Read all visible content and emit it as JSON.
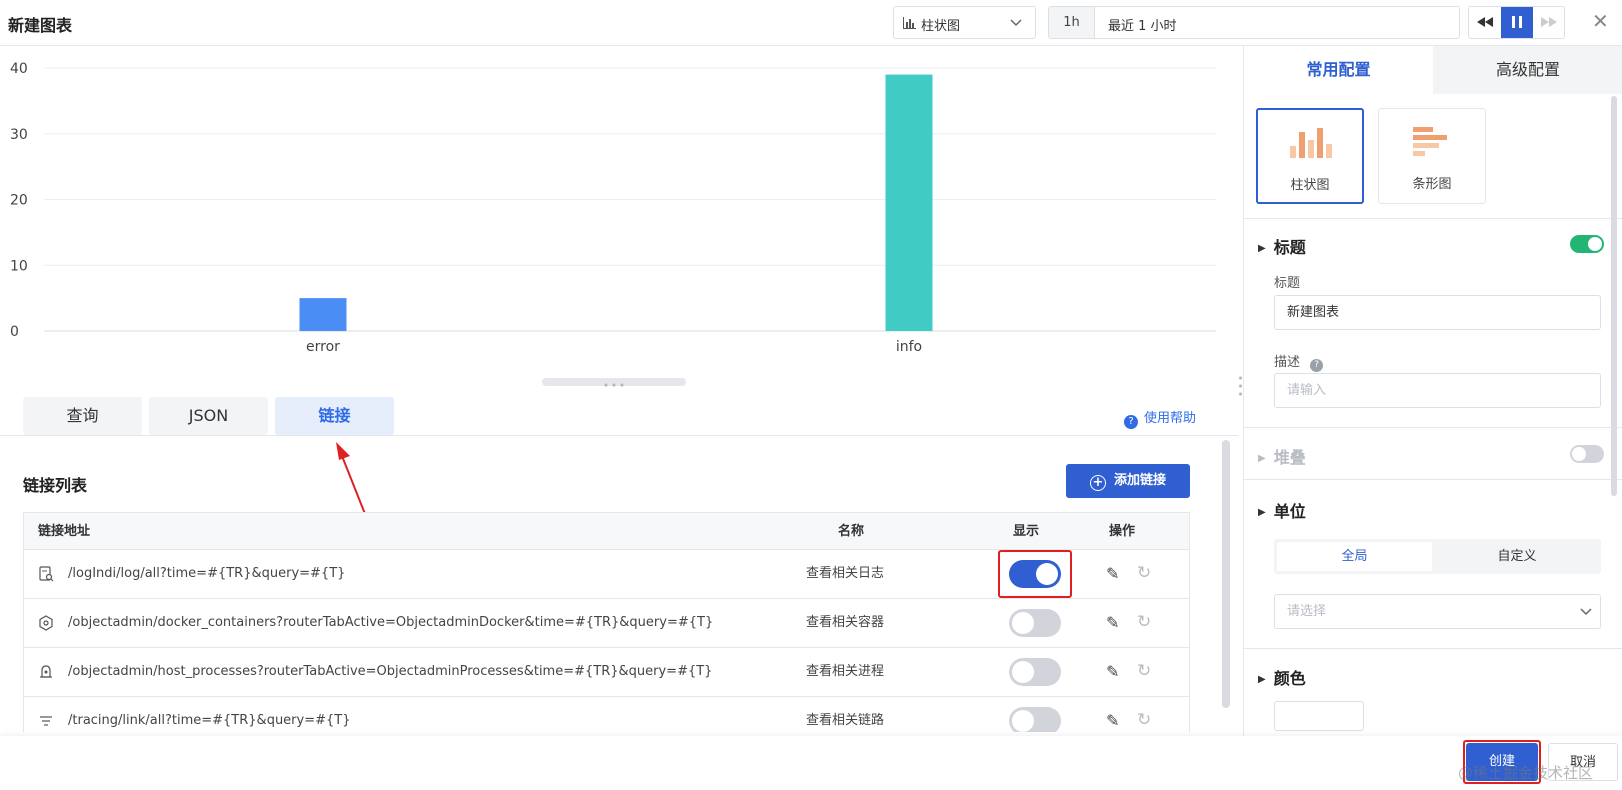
{
  "header": {
    "title": "新建图表",
    "chart_type_value": "柱状图",
    "time_short": "1h",
    "time_range": "最近 1 小时"
  },
  "chart_data": {
    "type": "bar",
    "categories": [
      "error",
      "info"
    ],
    "values": [
      5,
      39
    ],
    "colors": [
      "#4a8df5",
      "#40cbc4"
    ],
    "ylim": [
      0,
      40
    ],
    "yticks": [
      0,
      10,
      20,
      30,
      40
    ],
    "grid": true
  },
  "tabs": [
    {
      "label": "查询",
      "active": false
    },
    {
      "label": "JSON",
      "active": false
    },
    {
      "label": "链接",
      "active": true
    }
  ],
  "help_label": "使用帮助",
  "links": {
    "section_title": "链接列表",
    "add_button": "添加链接",
    "columns": {
      "address": "链接地址",
      "name": "名称",
      "show": "显示",
      "ops": "操作"
    },
    "rows": [
      {
        "icon": "log-search-icon",
        "address": "/logIndi/log/all?time=#{TR}&query=#{T}",
        "name": "查看相关日志",
        "show": true
      },
      {
        "icon": "container-icon",
        "address": "/objectadmin/docker_containers?routerTabActive=ObjectadminDocker&time=#{TR}&query=#{T}",
        "name": "查看相关容器",
        "show": false
      },
      {
        "icon": "process-icon",
        "address": "/objectadmin/host_processes?routerTabActive=ObjectadminProcesses&time=#{TR}&query=#{T}",
        "name": "查看相关进程",
        "show": false
      },
      {
        "icon": "trace-icon",
        "address": "/tracing/link/all?time=#{TR}&query=#{T}",
        "name": "查看相关链路",
        "show": false
      }
    ]
  },
  "right_panel": {
    "tabs": [
      "常用配置",
      "高级配置"
    ],
    "chart_options": [
      "柱状图",
      "条形图"
    ],
    "title_section": "标题",
    "title_label": "标题",
    "title_value": "新建图表",
    "desc_label": "描述",
    "desc_placeholder": "请输入",
    "stack_section": "堆叠",
    "unit_section": "单位",
    "unit_options": [
      "全局",
      "自定义"
    ],
    "unit_placeholder": "请选择",
    "color_section": "颜色"
  },
  "footer": {
    "create": "创建",
    "cancel": "取消",
    "watermark": "@稀土掘金技术社区"
  }
}
